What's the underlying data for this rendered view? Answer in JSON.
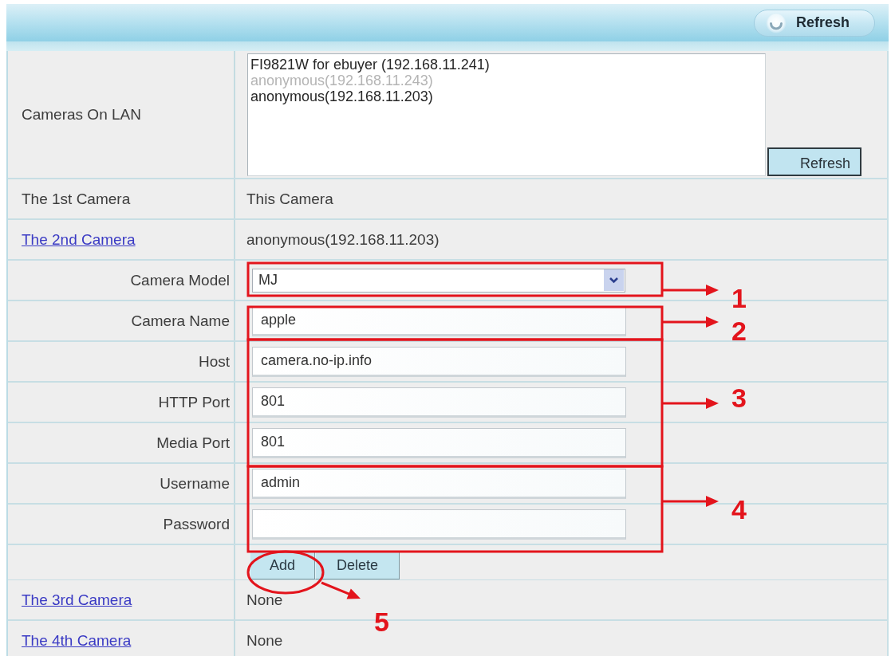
{
  "toolbar": {
    "refresh_button": "Refresh"
  },
  "rows": [
    {
      "kind": "camera_list",
      "label": "Cameras On LAN",
      "items": [
        {
          "text": "FI9821W for ebuyer (192.168.11.241)",
          "disabled": false
        },
        {
          "text": "anonymous(192.168.11.243)",
          "disabled": true
        },
        {
          "text": "anonymous(192.168.11.203)",
          "disabled": false
        }
      ],
      "button": "Refresh"
    },
    {
      "kind": "camera",
      "label": "The 1st Camera",
      "link": false,
      "value": "This Camera"
    },
    {
      "kind": "camera",
      "label": "The 2nd Camera",
      "link": true,
      "value": "anonymous(192.168.11.203)"
    },
    {
      "kind": "select",
      "label": "Camera Model",
      "value": "MJ"
    },
    {
      "kind": "input",
      "label": "Camera Name",
      "value": "apple"
    },
    {
      "kind": "input",
      "label": "Host",
      "value": "camera.no-ip.info"
    },
    {
      "kind": "input",
      "label": "HTTP Port",
      "value": "801"
    },
    {
      "kind": "input",
      "label": "Media Port",
      "value": "801"
    },
    {
      "kind": "input",
      "label": "Username",
      "value": "admin"
    },
    {
      "kind": "input",
      "label": "Password"
    },
    {
      "kind": "buttons",
      "buttons": [
        "Add",
        "Delete"
      ]
    },
    {
      "kind": "camera",
      "label": "The 3rd Camera",
      "link": true,
      "value": "None"
    },
    {
      "kind": "camera",
      "label": "The 4th Camera",
      "link": true,
      "value": "None"
    }
  ],
  "annotations": [
    {
      "kind": "frame",
      "label": "1"
    },
    {
      "kind": "frame",
      "label": "2"
    },
    {
      "kind": "frame",
      "label": "3"
    },
    {
      "kind": "frame",
      "label": "4"
    },
    {
      "kind": "ellipse",
      "label": "5"
    }
  ]
}
